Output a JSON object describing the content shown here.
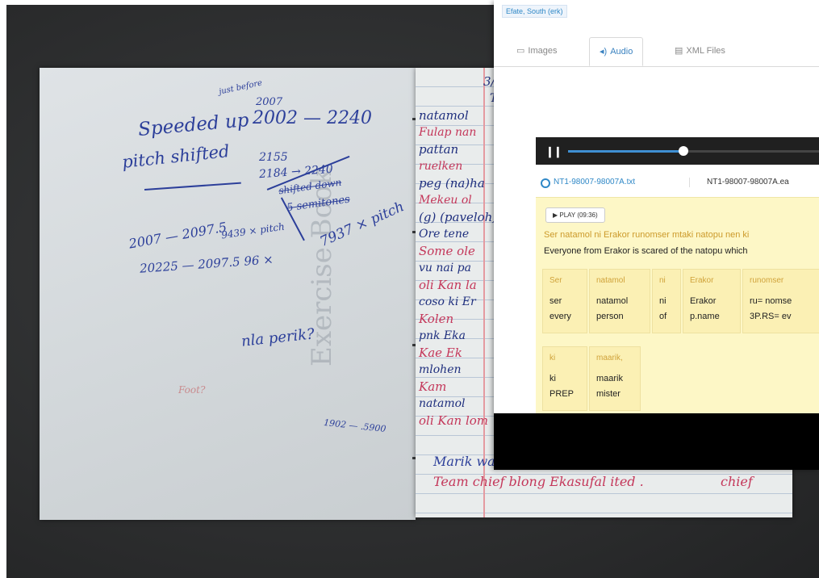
{
  "notebook": {
    "cover_print": "Exercise Book",
    "left_page": {
      "note_top": "just before",
      "range_1": "2007",
      "range_1_b": "2002 — 2240",
      "speeded_up": "Speeded up",
      "pitch_shifted": "pitch shifted",
      "n_2155": "2155",
      "n_2184": "2184 → 2240",
      "shifted_down": "shifted down",
      "semitones": "5 semitones",
      "n_7937": "7937 × pitch",
      "n_2007": "2007 — 2097.5",
      "n_9439": "9439 × pitch",
      "n_20225": "20225 — 2097.5  96 ×",
      "question": "nla perik?",
      "red_scribble": "Foot?",
      "bottom_range": "1902 — .5900"
    },
    "right_page": {
      "lines": [
        {
          "text": "3/",
          "color": "dark"
        },
        {
          "text": "T",
          "color": "dark"
        },
        {
          "text": "natamol",
          "color": "dark"
        },
        {
          "text": "Fulap nan",
          "color": "red"
        },
        {
          "text": "pattan",
          "color": "dark"
        },
        {
          "text": "ruelken",
          "color": "red"
        },
        {
          "text": "peg (na)ha",
          "color": "dark"
        },
        {
          "text": "Mekeu ol",
          "color": "red"
        },
        {
          "text": "(g) (paveloh)",
          "color": "dark"
        },
        {
          "text": "Ore tene",
          "color": "dark"
        },
        {
          "text": "Some ole",
          "color": "red"
        },
        {
          "text": "vu nai pa",
          "color": "dark"
        },
        {
          "text": "oli Kan la",
          "color": "red"
        },
        {
          "text": "coso ki Er",
          "color": "dark"
        },
        {
          "text": "Kolen",
          "color": "red"
        },
        {
          "text": "pnk Eka",
          "color": "dark"
        },
        {
          "text": "Kae Ek",
          "color": "red"
        },
        {
          "text": "mlohen",
          "color": "dark"
        },
        {
          "text": "Kam",
          "color": "red"
        },
        {
          "text": "natamol",
          "color": "dark"
        },
        {
          "text": "oli Kan lom",
          "color": "red"
        }
      ],
      "bottom_1": "Marik wake nen ki Ekasupe iked,",
      "bottom_2": "Team chief blong Ekasufal ited .",
      "bottom_3": "chief"
    }
  },
  "screenshot": {
    "breadcrumb": "Efate, South (erk)",
    "tabs": [
      {
        "icon": "image-icon",
        "glyph": "▭",
        "label": "Images"
      },
      {
        "icon": "audio-icon",
        "glyph": "◂)",
        "label": "Audio"
      },
      {
        "icon": "xml-file-icon",
        "glyph": "▤",
        "label": "XML Files"
      }
    ],
    "active_tab": "Audio",
    "player": {
      "progress": 0.42
    },
    "files": {
      "primary": "NT1-98007-98007A.txt",
      "secondary": "NT1-98007-98007A.ea"
    },
    "play_button": "▶ PLAY (09:36)",
    "original_line": "Ser natamol ni Erakor runomser mtaki natopu nen ki",
    "free_translation": "Everyone from Erakor is scared of the natopu which",
    "words": [
      {
        "orig": "Ser",
        "morph": "ser",
        "gloss": "every"
      },
      {
        "orig": "natamol",
        "morph": "natamol",
        "gloss": "person"
      },
      {
        "orig": "ni",
        "morph": "ni",
        "gloss": "of"
      },
      {
        "orig": "Erakor",
        "morph": "Erakor",
        "gloss": "p.name"
      },
      {
        "orig": "runomser",
        "morph": "ru= nomse",
        "gloss": "3P.RS= ev"
      },
      {
        "orig": "ki",
        "morph": "ki",
        "gloss": "PREP"
      },
      {
        "orig": "maarik,",
        "morph": "maarik",
        "gloss": "mister"
      }
    ]
  }
}
